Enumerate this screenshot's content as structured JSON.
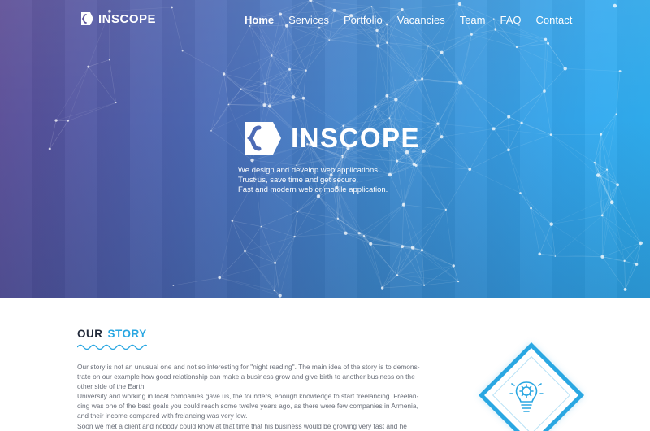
{
  "brand": {
    "name": "INSCOPE"
  },
  "nav": {
    "items": [
      {
        "label": "Home",
        "active": true
      },
      {
        "label": "Services",
        "active": false
      },
      {
        "label": "Portfolio",
        "active": false
      },
      {
        "label": "Vacancies",
        "active": false
      },
      {
        "label": "Team",
        "active": false
      },
      {
        "label": "FAQ",
        "active": false
      },
      {
        "label": "Contact",
        "active": false
      }
    ]
  },
  "hero": {
    "title": "INSCOPE",
    "tagline": [
      "We design and develop web applications.",
      "Trust us, save time and get secure.",
      "Fast and modern web or mobile application."
    ]
  },
  "story": {
    "title_part1": "OUR",
    "title_part2": "STORY",
    "paragraphs": [
      "Our story is not an unusual one and not so interesting for \"night reading\". The main idea of the story is to demons-",
      "trate on our example how good relationship can make a business grow and give birth to another business on the",
      "other side of the Earth.",
      "University and working in local companies gave us, the founders, enough knowledge to start freelancing. Freelan-",
      "cing was one of the best goals you could reach some twelve years ago, as there were few companies in Armenia,",
      "and their income compared with frelancing was very low.",
      "Soon we met a client and nobody could know at that time that his business would be growing very fast and he"
    ],
    "badge_icon": "lightbulb-gear-icon"
  },
  "colors": {
    "accent": "#2aa7e2",
    "heading_dark": "#222a3a",
    "body_text": "#6a6f79",
    "hero_left": "#5a4a94",
    "hero_right": "#2fb2f4"
  }
}
